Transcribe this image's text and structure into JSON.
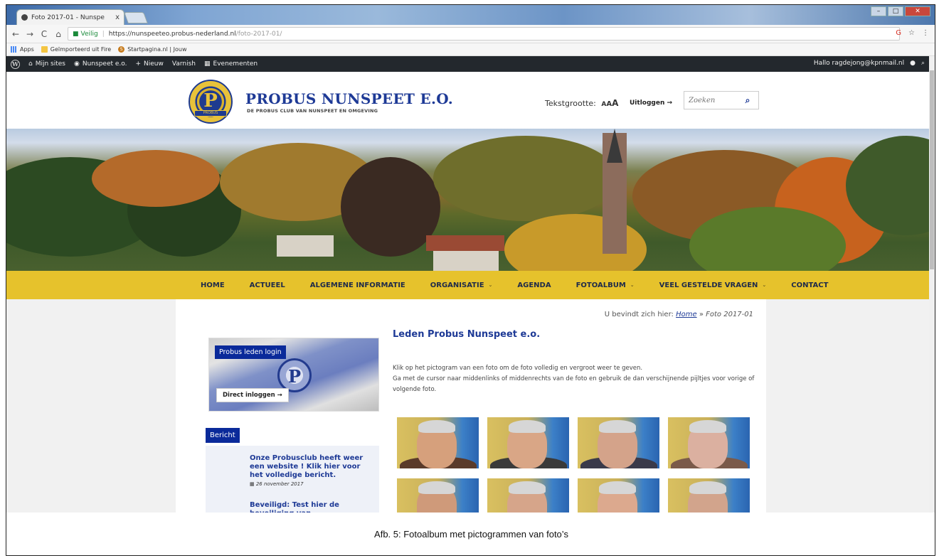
{
  "browser": {
    "tab_title": "Foto 2017-01 - Nunspe",
    "tab_close": "x",
    "nav": {
      "back": "←",
      "forward": "→",
      "reload": "C",
      "home": "⌂"
    },
    "security_label": "Veilig",
    "url_origin": "https://nunspeeteo.probus-nederland.nl",
    "url_path": "/foto-2017-01/",
    "bookmarks": [
      "Apps",
      "Geïmporteerd uit Fire",
      "Startpagina.nl | Jouw"
    ]
  },
  "wp_admin_bar": {
    "items": [
      "Mijn sites",
      "Nunspeet e.o.",
      "Nieuw",
      "Varnish",
      "Evenementen"
    ],
    "greeting": "Hallo ragdejong@kpnmail.nl"
  },
  "site": {
    "title": "PROBUS NUNSPEET E.O.",
    "subtitle": "DE PROBUS CLUB VAN NUNSPEET EN OMGEVING",
    "logo_band": "PROBUS",
    "font_size_label": "Tekstgrootte:",
    "logout_label": "Uitloggen →",
    "search_placeholder": "Zoeken"
  },
  "menu": [
    {
      "label": "HOME",
      "has_children": false
    },
    {
      "label": "ACTUEEL",
      "has_children": false
    },
    {
      "label": "ALGEMENE INFORMATIE",
      "has_children": false
    },
    {
      "label": "ORGANISATIE",
      "has_children": true
    },
    {
      "label": "AGENDA",
      "has_children": false
    },
    {
      "label": "FOTOALBUM",
      "has_children": true
    },
    {
      "label": "VEEL GESTELDE VRAGEN",
      "has_children": true
    },
    {
      "label": "CONTACT",
      "has_children": false
    }
  ],
  "breadcrumb": {
    "prefix": "U bevindt zich hier:",
    "home": "Home",
    "separator": "»",
    "current": "Foto 2017-01"
  },
  "sidebar": {
    "login_title": "Probus leden login",
    "login_button": "Direct inloggen →",
    "bericht_label": "Bericht",
    "posts": [
      {
        "title": "Onze Probusclub heeft weer een website ! Klik hier voor het volledige bericht.",
        "date": "26 november 2017"
      },
      {
        "title": "Beveiligd: Test hier de beveiliging van privacygevoelige berichten",
        "date": ""
      }
    ]
  },
  "main": {
    "heading": "Leden Probus Nunspeet e.o.",
    "intro_1": "Klik op het pictogram van een foto om de foto volledig en vergroot weer te geven.",
    "intro_2": "Ga met de cursor naar middenlinks of middenrechts van de foto en gebruik de dan verschijnende pijltjes voor vorige of volgende foto.",
    "thumbnails": 8
  },
  "caption": "Afb. 5: Fotoalbum met pictogrammen van foto’s",
  "colors": {
    "brand_blue": "#1e3a96",
    "nav_yellow": "#e6c22c",
    "label_blue": "#0a2a9a",
    "wp_bar": "#23282d"
  }
}
